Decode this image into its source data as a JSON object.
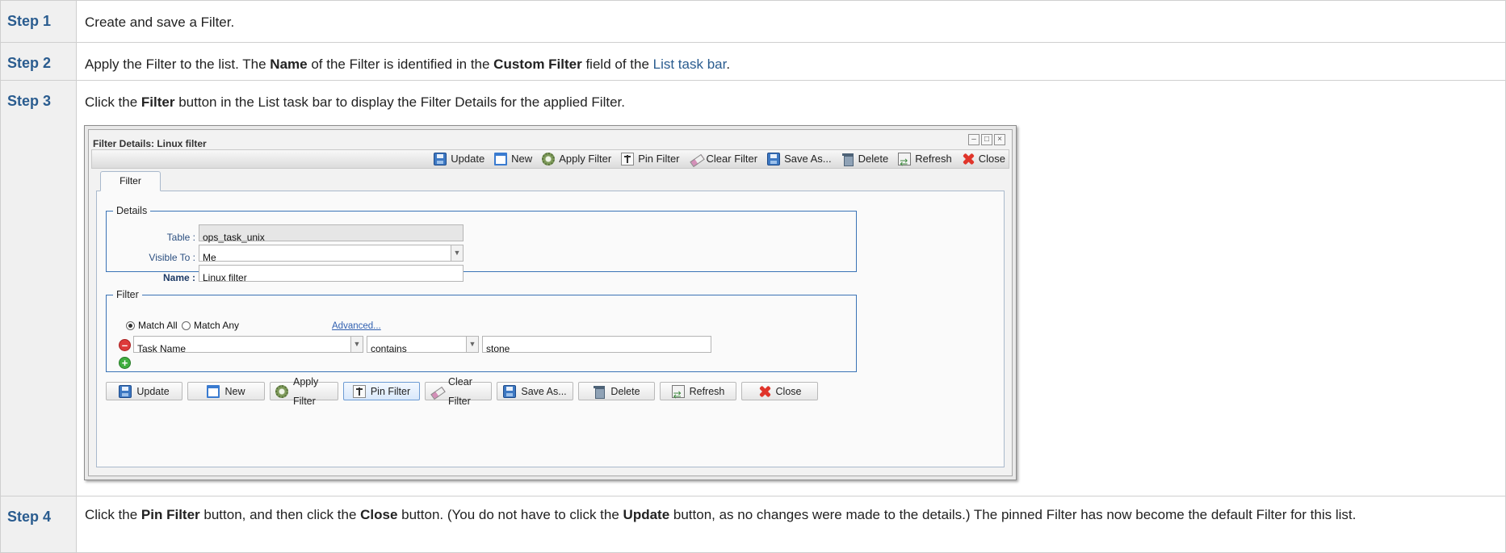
{
  "steps": [
    {
      "label": "Step 1",
      "text": "Create and save a Filter."
    },
    {
      "label": "Step 2",
      "parts": [
        "Apply the Filter to the list. The ",
        "Name",
        " of the Filter is identified in the ",
        "Custom Filter",
        " field of the ",
        "List task bar",
        "."
      ]
    },
    {
      "label": "Step 3",
      "parts": [
        "Click the ",
        "Filter",
        " button in the List task bar to display the Filter Details for the applied Filter."
      ]
    },
    {
      "label": "Step 4",
      "parts": [
        "Click the ",
        "Pin Filter",
        " button, and then click the ",
        "Close",
        " button. (You do not have to click the ",
        "Update",
        " button, as no changes were made to the details.) The pinned Filter has now become the default Filter for this list."
      ]
    }
  ],
  "window": {
    "title": "Filter Details: Linux filter",
    "toolbar": [
      "Update",
      "New",
      "Apply Filter",
      "Pin Filter",
      "Clear Filter",
      "Save As...",
      "Delete",
      "Refresh",
      "Close"
    ],
    "tab": "Filter",
    "details": {
      "legend": "Details",
      "table_label": "Table :",
      "table_value": "ops_task_unix",
      "visible_label": "Visible To :",
      "visible_value": "Me",
      "name_label": "Name :",
      "name_value": "Linux filter"
    },
    "filter": {
      "legend": "Filter",
      "match_all": "Match All",
      "match_any": "Match Any",
      "advanced": "Advanced...",
      "field": "Task Name",
      "operator": "contains",
      "value": "stone"
    },
    "buttons": [
      "Update",
      "New",
      "Apply Filter",
      "Pin Filter",
      "Clear Filter",
      "Save As...",
      "Delete",
      "Refresh",
      "Close"
    ]
  }
}
